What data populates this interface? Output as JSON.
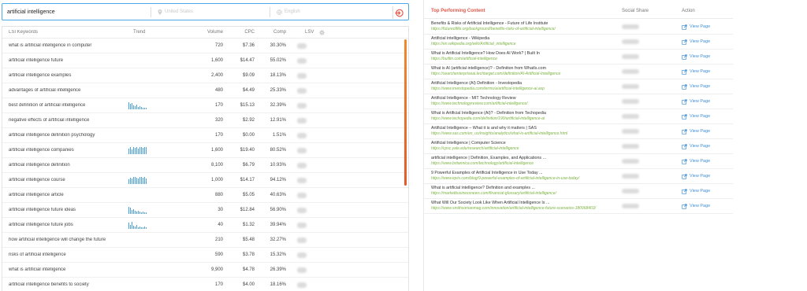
{
  "search": {
    "query": "artificial intelligence",
    "location_placeholder": "United States",
    "language_placeholder": "English"
  },
  "keywords": {
    "headers": {
      "keyword": "LSI Keywords",
      "trend": "Trend",
      "volume": "Volume",
      "cpc": "CPC",
      "comp": "Comp",
      "lsv": "LSV"
    },
    "rows": [
      {
        "keyword": "what is artificial intelligence in computer",
        "volume": "720",
        "cpc": "$7.36",
        "comp": "30.30%",
        "trend": []
      },
      {
        "keyword": "artificial intelligence future",
        "volume": "1,600",
        "cpc": "$14.47",
        "comp": "55.02%",
        "trend": []
      },
      {
        "keyword": "artificial intelligence examples",
        "volume": "2,400",
        "cpc": "$9.09",
        "comp": "18.13%",
        "trend": []
      },
      {
        "keyword": "advantages of artificial intelligence",
        "volume": "480",
        "cpc": "$4.49",
        "comp": "25.33%",
        "trend": []
      },
      {
        "keyword": "best definition of artificial intelligence",
        "volume": "170",
        "cpc": "$15.13",
        "comp": "32.39%",
        "trend": [
          10,
          7,
          8,
          5,
          4,
          6,
          3,
          4,
          3,
          2,
          2,
          2
        ]
      },
      {
        "keyword": "negative effects of artificial intelligence",
        "volume": "320",
        "cpc": "$2.92",
        "comp": "12.91%",
        "trend": []
      },
      {
        "keyword": "artificial intelligence definition psychology",
        "volume": "170",
        "cpc": "$0.00",
        "comp": "1.51%",
        "trend": []
      },
      {
        "keyword": "artificial intelligence companies",
        "volume": "1,600",
        "cpc": "$19.40",
        "comp": "80.52%",
        "trend": [
          7,
          9,
          6,
          10,
          8,
          9,
          7,
          10,
          9,
          8,
          10,
          9
        ]
      },
      {
        "keyword": "artificial intelligence definition",
        "volume": "8,100",
        "cpc": "$6.79",
        "comp": "10.93%",
        "trend": []
      },
      {
        "keyword": "artificial intelligence course",
        "volume": "1,000",
        "cpc": "$14.17",
        "comp": "94.12%",
        "trend": [
          6,
          8,
          7,
          9,
          10,
          8,
          7,
          9,
          10,
          8,
          9,
          7
        ]
      },
      {
        "keyword": "artificial intelligence article",
        "volume": "880",
        "cpc": "$5.05",
        "comp": "40.63%",
        "trend": []
      },
      {
        "keyword": "artificial intelligence future ideas",
        "volume": "30",
        "cpc": "$12.84",
        "comp": "56.90%",
        "trend": [
          10,
          8,
          5,
          6,
          4,
          3,
          4,
          3,
          2,
          3,
          2,
          2
        ]
      },
      {
        "keyword": "artificial intelligence future jobs",
        "volume": "40",
        "cpc": "$1.32",
        "comp": "39.94%",
        "trend": [
          8,
          5,
          9,
          4,
          3,
          5,
          2,
          3,
          2,
          2,
          3,
          2
        ]
      },
      {
        "keyword": "how artificial intelligence will change the future",
        "volume": "210",
        "cpc": "$5.48",
        "comp": "32.27%",
        "trend": []
      },
      {
        "keyword": "risks of artificial intelligence",
        "volume": "590",
        "cpc": "$3.78",
        "comp": "15.32%",
        "trend": []
      },
      {
        "keyword": "what is artificial intelligence",
        "volume": "9,900",
        "cpc": "$4.78",
        "comp": "26.39%",
        "trend": []
      },
      {
        "keyword": "artificial intelligence benefits to society",
        "volume": "170",
        "cpc": "$4.00",
        "comp": "18.16%",
        "trend": []
      }
    ]
  },
  "top_content": {
    "headers": {
      "title": "Top Performing Content",
      "social": "Social Share",
      "action": "Action"
    },
    "view_label": "View Page",
    "rows": [
      {
        "title": "Benefits & Risks of Artificial Intelligence - Future of Life Institute",
        "url": "https://futureoflife.org/background/benefits-risks-of-artificial-intelligence/"
      },
      {
        "title": "Artificial intelligence - Wikipedia",
        "url": "https://en.wikipedia.org/wiki/Artificial_intelligence"
      },
      {
        "title": "What is Artificial Intelligence? How Does AI Work? | Built In",
        "url": "https://builtin.com/artificial-intelligence"
      },
      {
        "title": "What is AI (artificial intelligence)? - Definition from WhatIs.com",
        "url": "https://searchenterpriseai.techtarget.com/definition/AI-Artificial-Intelligence"
      },
      {
        "title": "Artificial Intelligence (AI) Definition - Investopedia",
        "url": "https://www.investopedia.com/terms/a/artificial-intelligence-ai.asp"
      },
      {
        "title": "Artificial Intelligence - MIT Technology Review",
        "url": "https://www.technologyreview.com/artificial-intelligence/"
      },
      {
        "title": "What is Artificial Intelligence (AI)? - Definition from Techopedia",
        "url": "https://www.techopedia.com/definition/190/artificial-intelligence-ai"
      },
      {
        "title": "Artificial Intelligence – What it is and why it matters | SAS",
        "url": "https://www.sas.com/en_us/insights/analytics/what-is-artificial-intelligence.html"
      },
      {
        "title": "Artificial Intelligence | Computer Science",
        "url": "https://cpsc.yale.edu/research/artificial-intelligence"
      },
      {
        "title": "artificial intelligence | Definition, Examples, and Applications ...",
        "url": "https://www.britannica.com/technology/artificial-intelligence"
      },
      {
        "title": "9 Powerful Examples of Artificial Intelligence in Use Today ...",
        "url": "https://www.iqvis.com/blog/9-powerful-examples-of-artificial-intelligence-in-use-today/"
      },
      {
        "title": "What is artificial intelligence? Definition and examples ...",
        "url": "https://marketbusinessnews.com/financial-glossary/artificial-intelligence/"
      },
      {
        "title": "What Will Our Society Look Like When Artificial Intelligence Is ...",
        "url": "https://www.smithsonianmag.com/innovation/artificial-intelligence-future-scenarios-180968403/"
      }
    ]
  },
  "colors": {
    "accent": "#4aa8e8",
    "title_red": "#e2584a",
    "url_green": "#7cb342",
    "link_blue": "#3f8fd6",
    "trend_blue": "#4aa3e0",
    "scroll_orange": "#e45a2b"
  }
}
